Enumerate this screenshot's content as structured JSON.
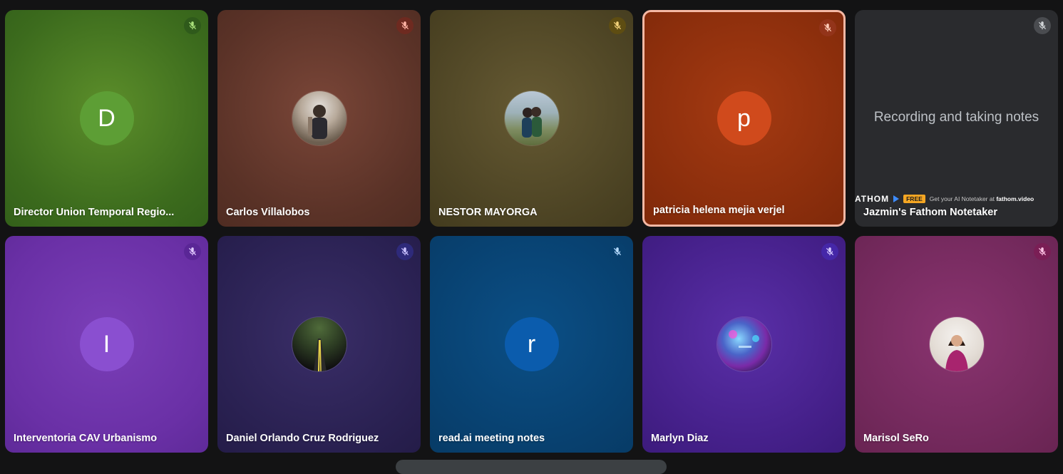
{
  "tiles": [
    {
      "name": "Director Union Temporal Regio...",
      "initial": "D",
      "avatar_color": "#5d9e35",
      "bg": "radial-gradient(circle at 50% 45%, #5c8e2a 0%, #3c6b1d 70%, #33601a 100%)",
      "mic_bg": "#2f5a1b",
      "mic_fg": "#a8e07a",
      "speaking": false
    },
    {
      "name": "Carlos Villalobos",
      "avatar_photo": "person-portrait",
      "bg": "radial-gradient(circle at 50% 45%, #7a4638 0%, #5a3227 70%, #4f2c22 100%)",
      "mic_bg": "#6e2a20",
      "mic_fg": "#ffb3a4",
      "speaking": false
    },
    {
      "name": "NESTOR MAYORGA",
      "avatar_photo": "couple-outdoors",
      "bg": "radial-gradient(circle at 50% 45%, #665a33 0%, #4d4424 70%, #433b1e 100%)",
      "mic_bg": "#5e4d12",
      "mic_fg": "#f2d27a",
      "speaking": false
    },
    {
      "name": "patricia helena mejia verjel",
      "initial": "p",
      "avatar_color": "#d04a1c",
      "bg": "radial-gradient(circle at 50% 45%, #a53a12 0%, #8b2e0c 70%, #7f290a 100%)",
      "mic_bg": "#93341a",
      "mic_fg": "#ffcbb8",
      "speaking": true
    },
    {
      "name": "Jazmin's Fathom Notetaker",
      "notes_text": "Recording and taking notes",
      "fathom_brand": "ATHOM",
      "fathom_free": "FREE",
      "fathom_cta_prefix": "Get your AI Notetaker at",
      "fathom_cta_link": "fathom.video",
      "bg": "#2a2b2e",
      "mic_bg": "#4a4c50",
      "mic_fg": "#d0d3d6",
      "speaking": false
    },
    {
      "name": "Interventoria CAV Urbanismo",
      "initial": "I",
      "avatar_color": "#8a4fd0",
      "bg": "radial-gradient(circle at 50% 45%, #7b3fb8 0%, #6a30a6 70%, #5f2a99 100%)",
      "mic_bg": "#5a2696",
      "mic_fg": "#e0c8ff",
      "speaking": false
    },
    {
      "name": "Daniel Orlando Cruz Rodriguez",
      "avatar_photo": "road-night",
      "bg": "radial-gradient(circle at 50% 45%, #3a2e68 0%, #2a2152 70%, #241c48 100%)",
      "mic_bg": "#2e2a7a",
      "mic_fg": "#c8c0ff",
      "speaking": false
    },
    {
      "name": "read.ai meeting notes",
      "initial": "r",
      "avatar_color": "#0b5cad",
      "bg": "radial-gradient(circle at 50% 45%, #0b4f86 0%, #084170 70%, #073b66 100%)",
      "mic_bg": "#08406e",
      "mic_fg": "#b8dcff",
      "speaking": false
    },
    {
      "name": "Marlyn Diaz",
      "avatar_photo": "neon-scene",
      "bg": "radial-gradient(circle at 50% 45%, #5a2fa8 0%, #45208a 70%, #3c1b7c 100%)",
      "mic_bg": "#4527a8",
      "mic_fg": "#d6c8ff",
      "speaking": false
    },
    {
      "name": "Marisol SeRo",
      "avatar_photo": "woman-portrait",
      "bg": "radial-gradient(circle at 50% 45%, #8a3470 0%, #73295c 70%, #692452 100%)",
      "mic_bg": "#7a1e55",
      "mic_fg": "#ffc2e4",
      "speaking": false
    }
  ]
}
